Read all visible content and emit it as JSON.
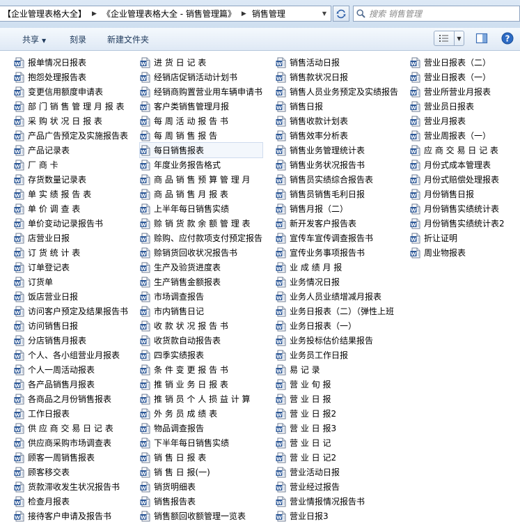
{
  "address": {
    "crumbs": [
      "【企业管理表格大全】",
      "《企业管理表格大全 - 销售管理篇》",
      "销售管理"
    ],
    "search_placeholder": "搜索 销售管理"
  },
  "toolbar": {
    "share": "共享",
    "burn": "刻录",
    "new_folder": "新建文件夹"
  },
  "columns": [
    [
      "报单情况日报表",
      "抱怨处理报告表",
      "变更信用额度申请表",
      "部 门 销 售 管 理 月 报 表",
      "采 购 状 况 日 报 表",
      "产品广告预定及实施报告表",
      "产品记录表",
      "厂 商 卡",
      "存货数量记录表",
      "单 实 绩 报 告 表",
      "单 价 调 查 表",
      "单价变动记录报告书",
      "店营业日报",
      "订 货 统 计 表",
      "订单登记表",
      "订货单",
      "饭店营业日报",
      "访问客户预定及结果报告书",
      "访问销售日报",
      "分店销售月报表",
      "个人、各小组营业月报表",
      "个人一周活动报表",
      "各产品销售月报表",
      "各商品之月份销售报表",
      "工作日报表",
      "供 应 商 交 易 日 记 表",
      "供应商采购市场调查表",
      "顾客一周销售报表",
      "顾客移交表",
      "货款滞收发生状况报告书",
      "检查月报表",
      "接待客户申请及报告书"
    ],
    [
      "进 货 日 记 表",
      "经销店促销活动计划书",
      "经销商购置营业用车辆申请书",
      "客户类销售管理月报",
      "每 周 活 动 报 告 书",
      "每 周 销 售 报 告",
      "每日销售报表",
      "年度业务报告格式",
      "商 品 销 售 预 算 管 理 月",
      "商 品 销 售 月 报 表",
      "上半年每日销售实绩",
      "赊 销 货 款 余 额 管 理 表",
      "赊购、应付款项支付预定报告",
      "赊销货回收状况报告书",
      "生产及验货进度表",
      "生产销售金额报表",
      "市场调查报告",
      "市内销售日记",
      "收 款 状 况 报 告 书",
      "收货款自动报告表",
      "四季实绩报表",
      "条 件 变 更 报 告 书",
      "推 销 业 务 日 报 表",
      "推 销 员 个 人 损 益 计 算",
      "外 务 员 成 绩 表",
      "物品调查报告",
      "下半年每日销售实绩",
      "销 售 日 报 表",
      "销 售 日 报(一)",
      "销货明细表",
      "销售报告表",
      "销售额回收额管理一览表"
    ],
    [
      "销售活动日报",
      "销售款状况日报",
      "销售人员业务预定及实绩报告",
      "销售日报",
      "销售收款计划表",
      "销售效率分析表",
      "销售业务管理统计表",
      "销售业务状况报告书",
      "销售员实绩综合报告表",
      "销售员销售毛利日报",
      "销售月报（二）",
      "新开发客户报告表",
      "宣传车宣传调查报告书",
      "宣传业务事项报告书",
      "业 成 绩 月 报",
      "业务情况日报",
      "业务人员业绩增减月报表",
      "业务日报表（二）（弹性上班",
      "业务日报表（一）",
      "业务投标估价结果报告",
      "业务员工作日报",
      "易 记 录",
      "营 业 旬 报",
      "营 业 日 报",
      "营 业 日 报2",
      "营 业 日 报3",
      "营 业 日 记",
      "营 业 日 记2",
      "营业活动日报",
      "营业经过报告",
      "营业情报情况报告书",
      "营业日报3"
    ],
    [
      "营业日报表（二）",
      "营业日报表（一）",
      "营业所营业月报表",
      "营业员日报表",
      "营业月报表",
      "营业周报表（一）",
      "应 商 交 易 日 记 表",
      "月份式成本管理表",
      "月份式赔偿处理报表",
      "月份销售日报",
      "月份销售实绩统计表",
      "月份销售实绩统计表2",
      "折让证明",
      "周业物报表"
    ]
  ],
  "selected": [
    1,
    6
  ]
}
